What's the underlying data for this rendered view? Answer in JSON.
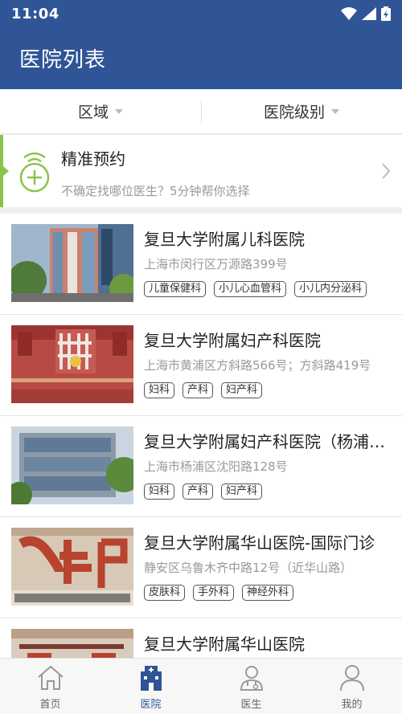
{
  "status": {
    "time": "11:04"
  },
  "header": {
    "title": "医院列表"
  },
  "filters": [
    {
      "label": "区域"
    },
    {
      "label": "医院级别"
    }
  ],
  "promo": {
    "title": "精准预约",
    "subtitle": "不确定找哪位医生？5分钟帮你选择"
  },
  "hospitals": [
    {
      "name": "复旦大学附属儿科医院",
      "address": "上海市闵行区万源路399号",
      "tags": [
        "儿童保健科",
        "小儿心血管科",
        "小儿内分泌科"
      ]
    },
    {
      "name": "复旦大学附属妇产科医院",
      "address": "上海市黄浦区方斜路566号；方斜路419号",
      "tags": [
        "妇科",
        "产科",
        "妇产科"
      ]
    },
    {
      "name": "复旦大学附属妇产科医院（杨浦院区）",
      "address": "上海市杨浦区沈阳路128号",
      "tags": [
        "妇科",
        "产科",
        "妇产科"
      ]
    },
    {
      "name": "复旦大学附属华山医院-国际门诊",
      "address": "静安区乌鲁木齐中路12号（近华山路）",
      "tags": [
        "皮肤科",
        "手外科",
        "神经外科"
      ]
    },
    {
      "name": "复旦大学附属华山医院",
      "address": "",
      "tags": []
    }
  ],
  "tabbar": [
    {
      "label": "首页",
      "icon": "home-icon"
    },
    {
      "label": "医院",
      "icon": "hospital-icon"
    },
    {
      "label": "医生",
      "icon": "doctor-icon"
    },
    {
      "label": "我的",
      "icon": "profile-icon"
    }
  ],
  "colors": {
    "primary": "#2f5597",
    "accent_green": "#8bc34a"
  }
}
